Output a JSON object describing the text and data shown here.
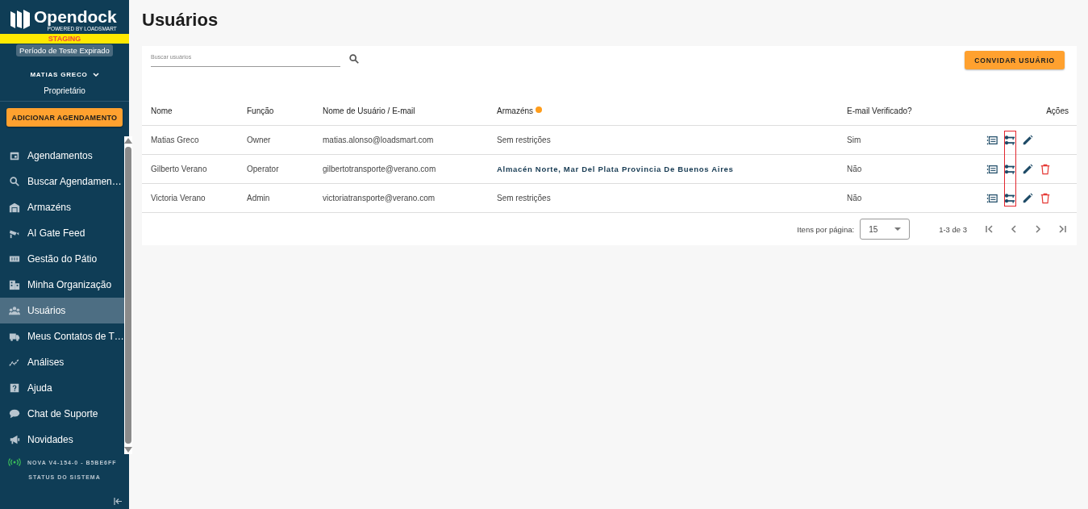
{
  "sidebar": {
    "brand": "Opendock",
    "brand_tagline": "POWERED BY LOADSMART",
    "environment": "STAGING",
    "trial_badge": "Período de Teste Expirado",
    "user": {
      "name": "MATIAS GRECO",
      "role": "Proprietário"
    },
    "primary_action": "ADICIONAR AGENDAMENTO",
    "items": [
      {
        "label": "Agendamentos",
        "kind": "calendar",
        "selected": false
      },
      {
        "label": "Buscar Agendamen…",
        "kind": "search",
        "selected": false
      },
      {
        "label": "Armazéns",
        "kind": "warehouse",
        "selected": false
      },
      {
        "label": "AI Gate Feed",
        "kind": "camera",
        "selected": false
      },
      {
        "label": "Gestão do Pátio",
        "kind": "columns",
        "selected": false
      },
      {
        "label": "Minha Organização",
        "kind": "building",
        "selected": false
      },
      {
        "label": "Usuários",
        "kind": "people",
        "selected": true
      },
      {
        "label": "Meus Contatos de T…",
        "kind": "truck",
        "selected": false
      },
      {
        "label": "Análises",
        "kind": "chart",
        "selected": false
      },
      {
        "label": "Ajuda",
        "kind": "help",
        "selected": false
      },
      {
        "label": "Chat de Suporte",
        "kind": "chat",
        "selected": false
      },
      {
        "label": "Novidades",
        "kind": "megaphone",
        "selected": false
      }
    ],
    "version": "NOVA V4-154-0 - B5BE6FF",
    "system_status": "STATUS DO SISTEMA"
  },
  "page": {
    "title": "Usuários",
    "search": {
      "placeholder": "Buscar usuários"
    },
    "invite_button": "CONVIDAR USUÁRIO",
    "table": {
      "columns": [
        "Nome",
        "Função",
        "Nome de Usuário / E-mail",
        "Armazéns",
        "E-mail Verificado?",
        "Ações"
      ],
      "rows": [
        {
          "name": "Matias Greco",
          "role": "Owner",
          "email": "matias.alonso@loadsmart.com",
          "warehouses": "Sem restrições",
          "kind": "plain",
          "verified": "Sim",
          "deletable": false
        },
        {
          "name": "Gilberto Verano",
          "role": "Operator",
          "email": "gilbertotransporte@verano.com",
          "warehouses": "Almacén Norte, Mar Del Plata Provincia De Buenos Aires",
          "kind": "named",
          "verified": "Não",
          "deletable": true
        },
        {
          "name": "Victoria Verano",
          "role": "Admin",
          "email": "victoriatransporte@verano.com",
          "warehouses": "Sem restrições",
          "kind": "plain",
          "verified": "Não",
          "deletable": true
        }
      ],
      "key_column_highlighted": true
    },
    "pagination": {
      "label": "Itens por página:",
      "per_page": "15",
      "range": "1-3 de 3"
    }
  }
}
